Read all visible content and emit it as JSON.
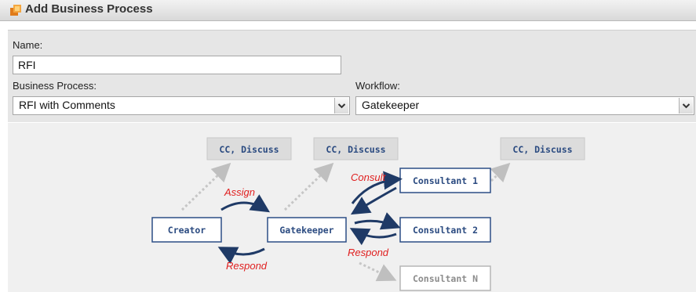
{
  "dialog": {
    "title": "Add Business Process",
    "icon": "process-icon"
  },
  "form": {
    "name_label": "Name:",
    "name_value": "RFI",
    "business_process_label": "Business Process:",
    "business_process_value": "RFI with Comments",
    "workflow_label": "Workflow:",
    "workflow_value": "Gatekeeper"
  },
  "diagram": {
    "cc_labels": [
      "CC, Discuss",
      "CC, Discuss",
      "CC, Discuss"
    ],
    "nodes": {
      "creator": "Creator",
      "gatekeeper": "Gatekeeper",
      "consultant1": "Consultant 1",
      "consultant2": "Consultant 2",
      "consultantN": "Consultant N"
    },
    "edges": {
      "assign": "Assign",
      "respond_left": "Respond",
      "consult": "Consult",
      "respond_right": "Respond"
    }
  }
}
